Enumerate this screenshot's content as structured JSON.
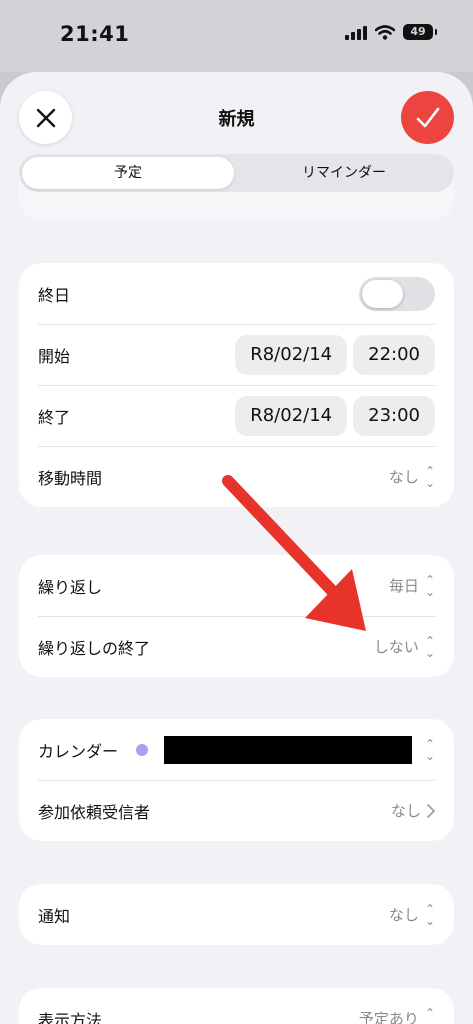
{
  "status": {
    "time": "21:41",
    "battery": "49"
  },
  "header": {
    "title": "新規"
  },
  "segments": [
    {
      "label": "予定"
    },
    {
      "label": "リマインダー"
    }
  ],
  "datetime": {
    "all_day": {
      "label": "終日",
      "on": false
    },
    "start": {
      "label": "開始",
      "date": "R8/02/14",
      "time": "22:00"
    },
    "end": {
      "label": "終了",
      "date": "R8/02/14",
      "time": "23:00"
    },
    "travel": {
      "label": "移動時間",
      "value": "なし"
    }
  },
  "repeat": {
    "repeat": {
      "label": "繰り返し",
      "value": "毎日"
    },
    "repeat_end": {
      "label": "繰り返しの終了",
      "value": "しない"
    }
  },
  "calendar": {
    "calendar": {
      "label": "カレンダー",
      "dot_color": "#b49cf0"
    },
    "invitees": {
      "label": "参加依頼受信者",
      "value": "なし"
    }
  },
  "notify": {
    "label": "通知",
    "value": "なし"
  },
  "display": {
    "label": "表示方法",
    "value": "予定あり"
  },
  "colors": {
    "accent": "#ee4440",
    "arrow": "#e8332a"
  }
}
